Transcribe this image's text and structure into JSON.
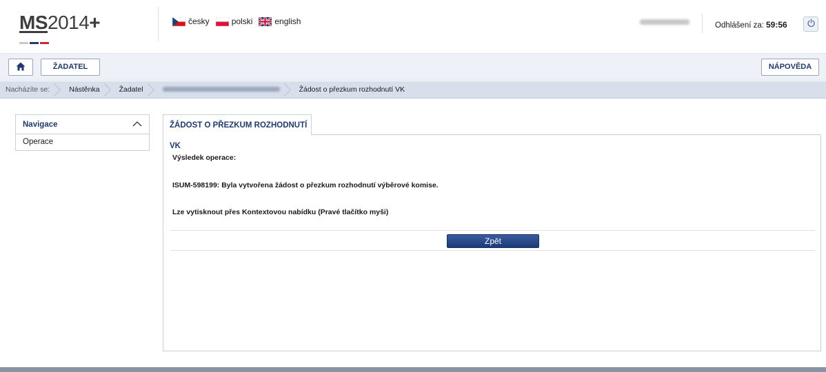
{
  "header": {
    "logo_prefix": "MS",
    "logo_suffix": "2014",
    "logo_plus": "+",
    "languages": [
      {
        "label": "česky",
        "flag": "cz-flag-icon"
      },
      {
        "label": "polski",
        "flag": "pl-flag-icon"
      },
      {
        "label": "english",
        "flag": "gb-flag-icon"
      }
    ],
    "logout_label": "Odhlášení za:",
    "logout_timer": "59:56"
  },
  "navbar": {
    "home_icon": "home-icon",
    "zadatel_label": "ŽADATEL",
    "help_label": "NÁPOVĚDA"
  },
  "breadcrumb": {
    "prefix": "Nacházíte se:",
    "items": [
      "Nástěnka",
      "Žadatel",
      "Žádost o přezkum rozhodnutí VK"
    ]
  },
  "sidebar": {
    "title": "Navigace",
    "items": [
      "Operace"
    ]
  },
  "main": {
    "tab_label": "ŽÁDOST O PŘEZKUM ROZHODNUTÍ VK",
    "result_heading": "Výsledek operace:",
    "result_message": "ISUM-598199: Byla vytvořena žádost o přezkum rozhodnutí výběrové komise.",
    "print_hint": "Lze vytisknout přes Kontextovou nabídku (Pravé tlačítko myši)",
    "back_label": "Zpět"
  },
  "colors": {
    "accent": "#1f3a6b",
    "button": "#2a4a8c",
    "breadcrumb_bg": "#d7dfec"
  }
}
